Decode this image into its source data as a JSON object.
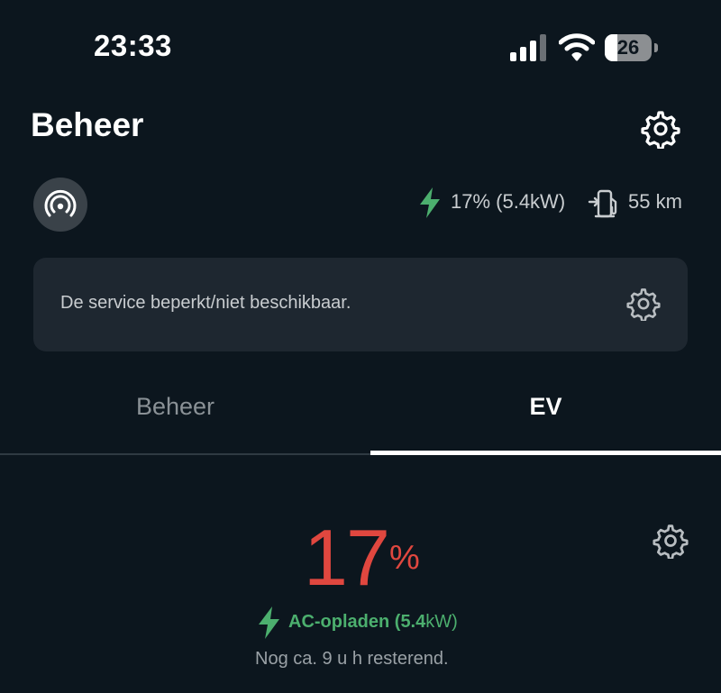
{
  "status_bar": {
    "time": "23:33",
    "battery_level": "26",
    "battery_fraction": 0.26
  },
  "header": {
    "title": "Beheer",
    "settings_icon": "gear-icon"
  },
  "info_row": {
    "connection_icon": "signal-broadcast-icon",
    "charge_icon": "lightning-bolt-icon",
    "charge_text": "17% (5.4kW)",
    "range_icon": "charging-station-icon",
    "range_text": "55 km"
  },
  "service_card": {
    "message": "De service beperkt/niet beschikbaar.",
    "icon": "gear-icon"
  },
  "tabs": [
    {
      "label": "Beheer",
      "active": false
    },
    {
      "label": "EV",
      "active": true
    }
  ],
  "ev_panel": {
    "soc": "17",
    "soc_unit": "%",
    "charging_label": "AC-opladen (",
    "charging_power_value": "5.4",
    "charging_power_unit": "kW)",
    "remaining": "Nog ca. 9 u h resterend."
  },
  "colors": {
    "background": "#0c161e",
    "card": "#1e2730",
    "accent_green": "#4caf6e",
    "soc_red": "#e0473f",
    "muted_text": "#9aa1a6"
  }
}
